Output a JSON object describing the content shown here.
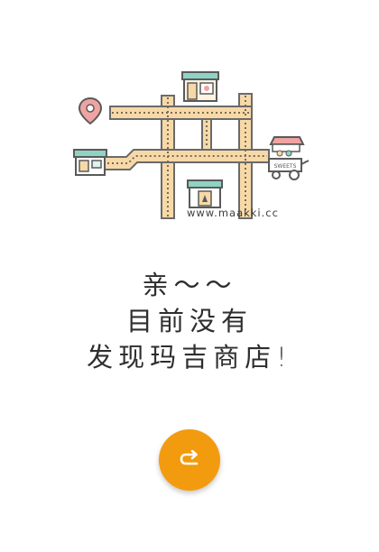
{
  "illustration": {
    "url_text": "www.maakki.cc",
    "icons": [
      "location-pin-icon",
      "cake-shop-icon",
      "store-icon",
      "boutique-icon",
      "sweets-cart-icon"
    ],
    "sweets_sign": "SWEETS"
  },
  "message": {
    "line1": "亲～～",
    "line2": "目前没有",
    "line3": "发现玛吉商店!"
  },
  "refresh_button": {
    "icon": "redo-icon"
  },
  "colors": {
    "accent": "#f39b0f",
    "road": "#f7d9a8",
    "road_edge": "#6a6a6a",
    "pin": "#e88a8a",
    "shop_teal": "#8fd3c4",
    "text": "#2e2e2e"
  }
}
